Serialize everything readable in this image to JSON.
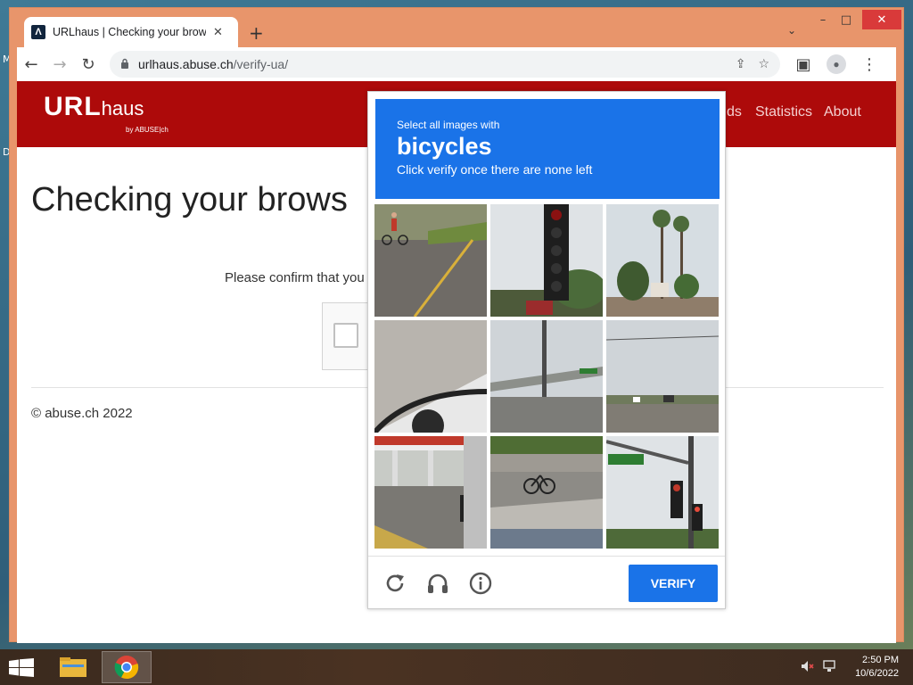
{
  "desktop": {
    "letters": [
      "M",
      "D"
    ]
  },
  "window": {
    "minimize_glyph": "–",
    "maximize_glyph": "□",
    "close_glyph": "✕"
  },
  "tab": {
    "title": "URLhaus | Checking your browser",
    "favicon_glyph": "Λ",
    "close_glyph": "✕"
  },
  "newtab_glyph": "+",
  "tabsearch_glyph": "⌄",
  "toolbar": {
    "back_glyph": "←",
    "forward_glyph": "→",
    "reload_glyph": "↻",
    "url_host": "urlhaus.abuse.ch",
    "url_path": "/verify-ua/",
    "share_glyph": "⇪",
    "bookmark_glyph": "☆",
    "sidepanel_glyph": "▣",
    "profile_glyph": "●",
    "menu_glyph": "⋮"
  },
  "site": {
    "logo_main": "URL",
    "logo_sub": "haus",
    "logo_by": "by ABUSE|ch",
    "nav": [
      "ds",
      "Statistics",
      "About"
    ],
    "heading": "Checking your brows",
    "confirm_text": "Please confirm that you",
    "footer": "© abuse.ch 2022"
  },
  "captcha": {
    "line1": "Select all images with",
    "keyword": "bicycles",
    "line3": "Click verify once there are none left",
    "verify_label": "VERIFY",
    "tiles": [
      "road-cyclist",
      "traffic-light",
      "palm-trees",
      "gravel-car",
      "overpass",
      "intersection",
      "gas-station",
      "sidewalk-bicycle",
      "street-sign-light"
    ],
    "accent": "#1a73e8"
  },
  "taskbar": {
    "time": "2:50 PM",
    "date": "10/6/2022",
    "apps": [
      "file-explorer",
      "chrome"
    ]
  },
  "colors": {
    "site_header": "#ad0a0a",
    "window_frame": "#e8956b"
  }
}
